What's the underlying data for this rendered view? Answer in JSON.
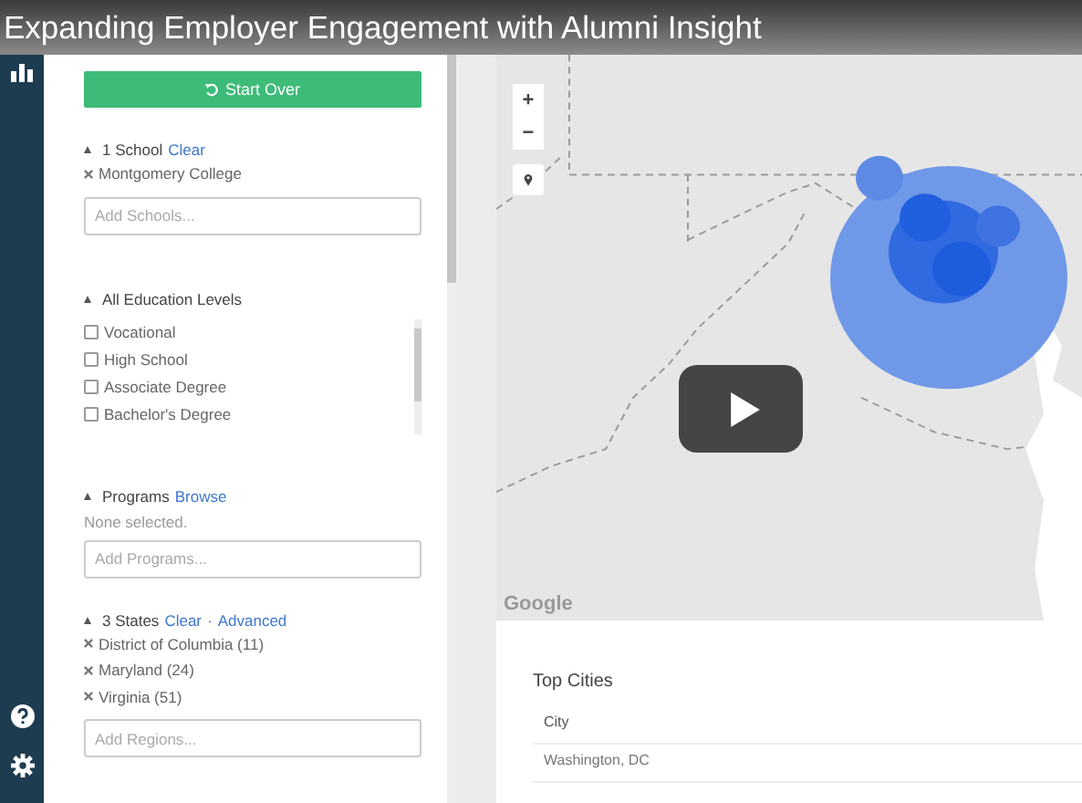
{
  "video": {
    "title": "Expanding Employer Engagement with Alumni Insight"
  },
  "sidebar": {
    "start_over": "Start Over",
    "sections": [
      {
        "kind": "chips",
        "heading": "1 School",
        "links": [
          "Clear"
        ],
        "chips": [
          "Montgomery College"
        ],
        "placeholder": "Add Schools..."
      },
      {
        "kind": "checklist",
        "heading": "All Education Levels",
        "options": [
          {
            "label": "Vocational",
            "checked": false
          },
          {
            "label": "High School",
            "checked": false
          },
          {
            "label": "Associate Degree",
            "checked": false
          },
          {
            "label": "Bachelor's Degree",
            "checked": false
          }
        ]
      },
      {
        "kind": "note",
        "heading": "Programs",
        "links": [
          "Browse"
        ],
        "note": "None selected.",
        "placeholder": "Add Programs..."
      },
      {
        "kind": "chips",
        "heading": "3 States",
        "links": [
          "Clear",
          "Advanced"
        ],
        "separator": "·",
        "chips": [
          "District of Columbia (11)",
          "Maryland (24)",
          "Virginia (51)"
        ],
        "placeholder": "Add Regions..."
      }
    ]
  },
  "map": {
    "zoom_controls": [
      "+",
      "−"
    ],
    "attribution": "Google"
  },
  "top_cities": {
    "title": "Top Cities",
    "columns": [
      "City"
    ],
    "rows": [
      [
        "Washington, DC"
      ]
    ]
  }
}
